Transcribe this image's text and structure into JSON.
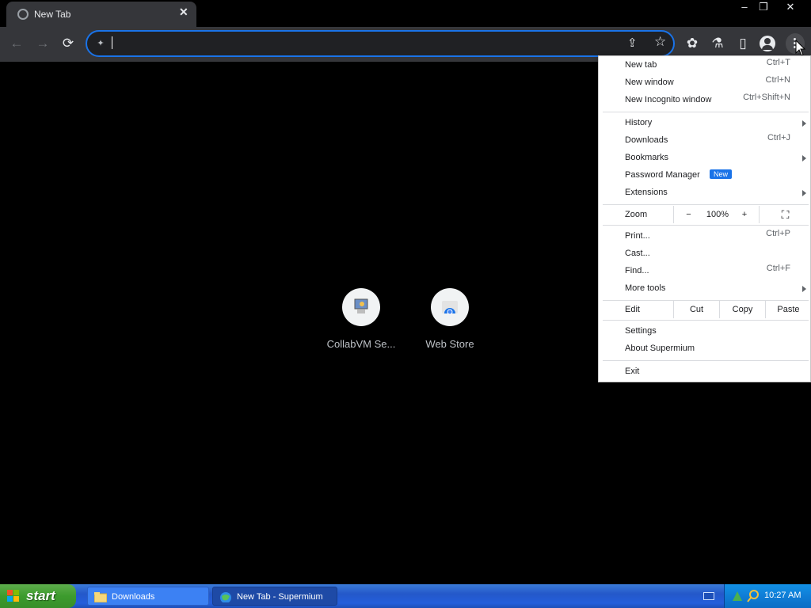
{
  "browser": {
    "tab": {
      "title": "New Tab",
      "close_glyph": "✕"
    },
    "window_controls": {
      "minimize": "–",
      "restore": "❐",
      "close": "✕"
    },
    "toolbar": {
      "back": "←",
      "forward": "→",
      "reload": "⟳",
      "omnibox_value": ""
    },
    "icons": {
      "share": "⇪",
      "bookmark": "☆",
      "extensions": "✿",
      "labs": "⚗",
      "side_panel": "▯"
    }
  },
  "shortcuts": [
    {
      "label": "CollabVM Se...",
      "icon": "collabvm-icon"
    },
    {
      "label": "Web Store",
      "icon": "web-store-icon"
    }
  ],
  "menu": {
    "new_tab": {
      "label": "New tab",
      "shortcut": "Ctrl+T"
    },
    "new_window": {
      "label": "New window",
      "shortcut": "Ctrl+N"
    },
    "new_incognito": {
      "label": "New Incognito window",
      "shortcut": "Ctrl+Shift+N"
    },
    "history": {
      "label": "History"
    },
    "downloads": {
      "label": "Downloads",
      "shortcut": "Ctrl+J"
    },
    "bookmarks": {
      "label": "Bookmarks"
    },
    "password_manager": {
      "label": "Password Manager",
      "badge": "New"
    },
    "extensions": {
      "label": "Extensions"
    },
    "zoom": {
      "label": "Zoom",
      "minus": "−",
      "value": "100%",
      "plus": "+",
      "fullscreen": "⛶"
    },
    "print": {
      "label": "Print...",
      "shortcut": "Ctrl+P"
    },
    "cast": {
      "label": "Cast..."
    },
    "find": {
      "label": "Find...",
      "shortcut": "Ctrl+F"
    },
    "more_tools": {
      "label": "More tools"
    },
    "edit": {
      "label": "Edit",
      "cut": "Cut",
      "copy": "Copy",
      "paste": "Paste"
    },
    "settings": {
      "label": "Settings"
    },
    "about": {
      "label": "About Supermium"
    },
    "exit": {
      "label": "Exit"
    }
  },
  "taskbar": {
    "start": "start",
    "buttons": [
      {
        "label": "Downloads",
        "icon": "folder-icon"
      },
      {
        "label": "New Tab - Supermium",
        "icon": "browser-icon"
      }
    ],
    "clock": "10:27 AM"
  },
  "colors": {
    "accent": "#1a73e8",
    "toolbar": "#35363a",
    "taskbar": "#245edb",
    "start": "#3c9b2d"
  }
}
